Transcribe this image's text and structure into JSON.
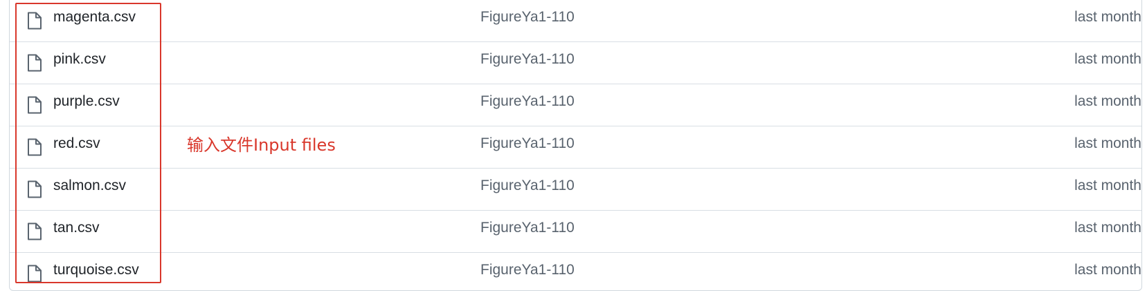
{
  "files": [
    {
      "name": "magenta.csv",
      "commit": "FigureYa1-110",
      "age": "last month"
    },
    {
      "name": "pink.csv",
      "commit": "FigureYa1-110",
      "age": "last month"
    },
    {
      "name": "purple.csv",
      "commit": "FigureYa1-110",
      "age": "last month"
    },
    {
      "name": "red.csv",
      "commit": "FigureYa1-110",
      "age": "last month"
    },
    {
      "name": "salmon.csv",
      "commit": "FigureYa1-110",
      "age": "last month"
    },
    {
      "name": "tan.csv",
      "commit": "FigureYa1-110",
      "age": "last month"
    },
    {
      "name": "turquoise.csv",
      "commit": "FigureYa1-110",
      "age": "last month"
    }
  ],
  "icon": "file-icon",
  "annotation": {
    "text": "输入文件Input files",
    "color": "#d9372b"
  }
}
